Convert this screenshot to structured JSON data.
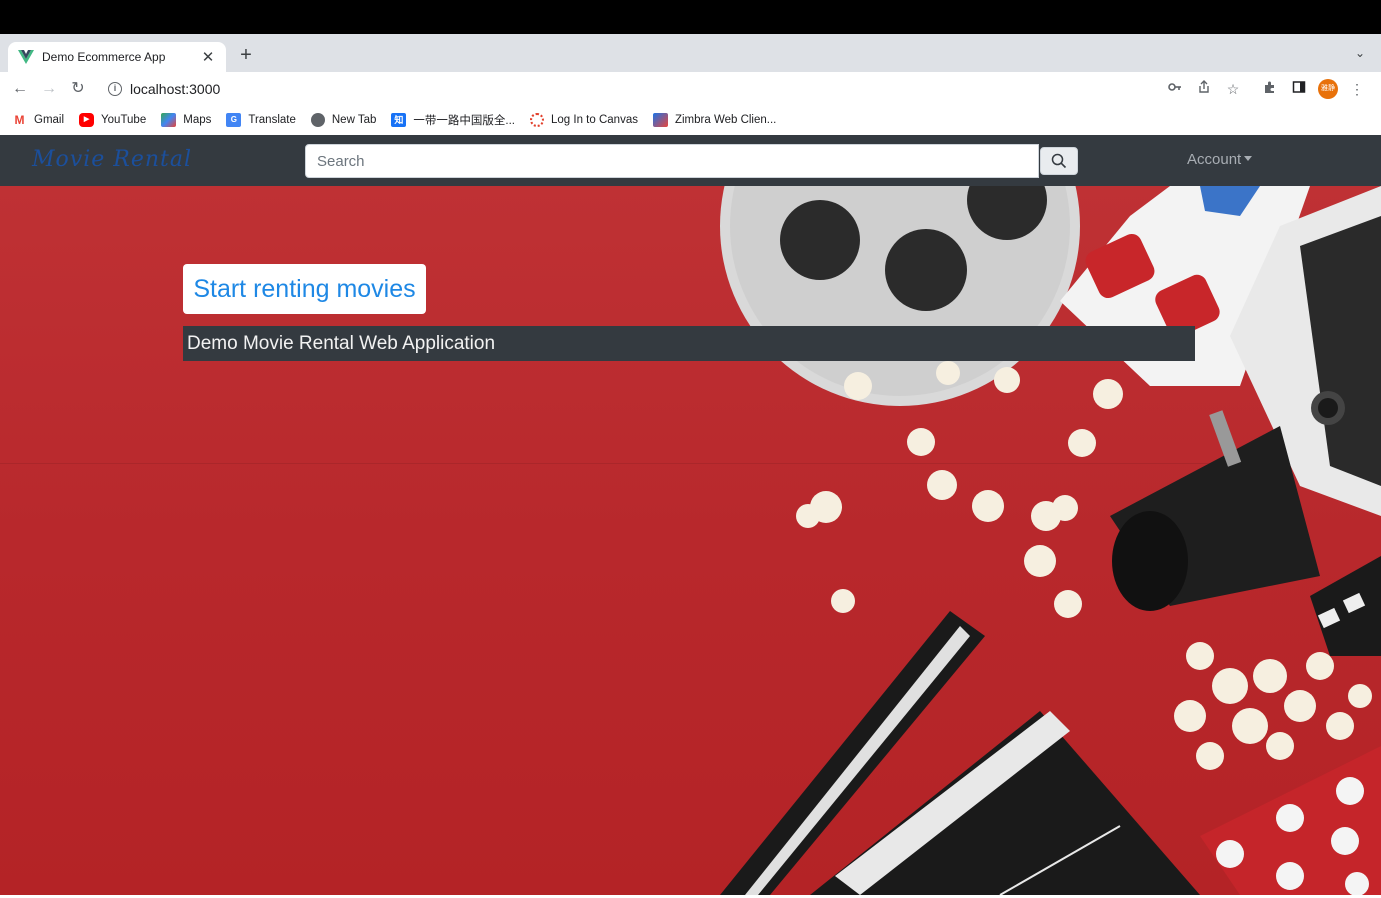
{
  "browser": {
    "tab_title": "Demo Ecommerce App",
    "url": "localhost:3000",
    "profile_label": "雅静",
    "bookmarks": [
      {
        "label": "Gmail"
      },
      {
        "label": "YouTube"
      },
      {
        "label": "Maps"
      },
      {
        "label": "Translate"
      },
      {
        "label": "New Tab"
      },
      {
        "label": "一带一路中国版全..."
      },
      {
        "label": "Log In to Canvas"
      },
      {
        "label": "Zimbra Web Clien..."
      }
    ]
  },
  "navbar": {
    "brand": "Movie Rental",
    "search_placeholder": "Search",
    "account_label": "Account"
  },
  "hero": {
    "cta_label": "Start renting movies",
    "subtitle": "Demo Movie Rental Web Application",
    "background_color": "#b8282c"
  },
  "colors": {
    "navbar": "#343a40",
    "cta_text": "#1e88e5",
    "brand": "#1b4f9c"
  }
}
